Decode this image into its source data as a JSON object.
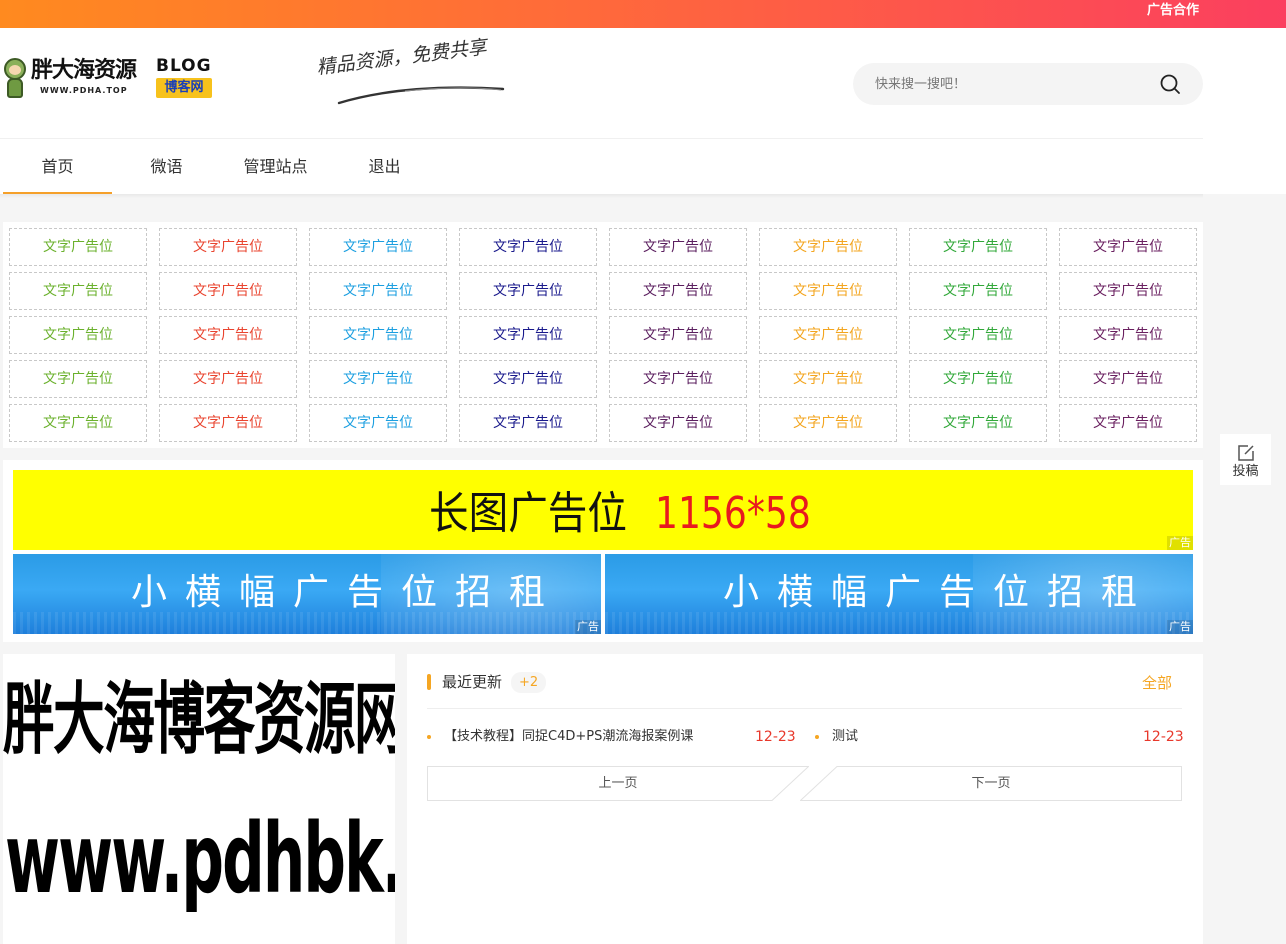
{
  "topbar": {
    "ad_link": "广告合作"
  },
  "logo": {
    "brand": "胖大海资源",
    "brand_url": "WWW.PDHA.TOP",
    "blog": "BLOG",
    "blog_cn": "博客网"
  },
  "slogan": "精品资源，免费共享",
  "search": {
    "placeholder": "快来搜一搜吧！"
  },
  "nav": {
    "items": [
      {
        "label": "首页",
        "active": true
      },
      {
        "label": "微语",
        "active": false
      },
      {
        "label": "管理站点",
        "active": false
      },
      {
        "label": "退出",
        "active": false
      }
    ]
  },
  "text_ads": {
    "label": "文字广告位",
    "columns": 8,
    "rows": 5,
    "column_colors": [
      "#6bb12d",
      "#e9442f",
      "#1c9fe0",
      "#1a1a8c",
      "#5b1f5f",
      "#f3a51f",
      "#32a83a",
      "#6a2060"
    ]
  },
  "banners": {
    "long_ad": {
      "text": "长图广告位",
      "size": "1156*58",
      "tag": "广告"
    },
    "small_ads": [
      {
        "text": "小横幅广告位招租",
        "tag": "广告"
      },
      {
        "text": "小横幅广告位招租",
        "tag": "广告"
      }
    ]
  },
  "side_image": {
    "line1": "胖大海博客资源网",
    "line2": "www.pdhbk.cn"
  },
  "latest": {
    "title": "最近更新",
    "badge": "+2",
    "all_label": "全部",
    "posts": [
      {
        "title": "【技术教程】同捉C4D+PS潮流海报案例课",
        "date": "12-23"
      },
      {
        "title": "测试",
        "date": "12-23"
      }
    ],
    "prev_label": "上一页",
    "next_label": "下一页"
  },
  "contribute": {
    "label": "投稿"
  },
  "colors": {
    "accent": "#f5a623",
    "date_red": "#e8382b",
    "long_ad_bg": "#ffff00",
    "long_ad_number": "#e8191f",
    "banner_blue": "#2b9be6"
  }
}
